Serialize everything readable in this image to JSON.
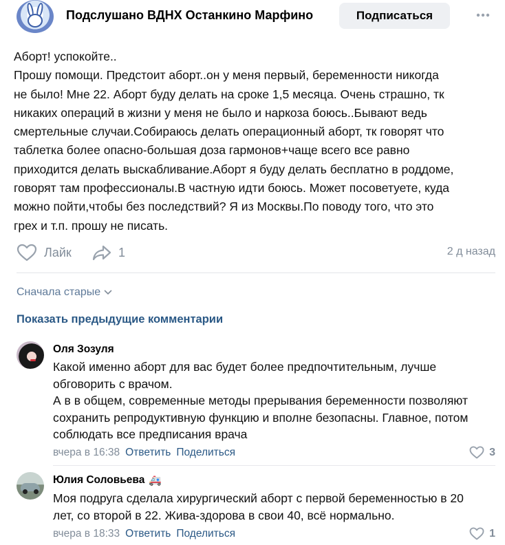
{
  "header": {
    "group_title": "Подслушано ВДНХ Останкино Марфино",
    "subscribe_label": "Подписаться"
  },
  "post": {
    "lines": [
      "Аборт! успокойте..",
      "Прошу помощи. Предстоит аборт..он у меня первый, беременности никогда",
      "не было! Мне 22. Аборт буду делать на сроке 1,5 месяца. Очень страшно, тк",
      "никаких операций в жизни у меня не было и наркоза боюсь..Бывают ведь",
      "смертельные случаи.Собираюсь делать операционный аборт, тк говорят что",
      "таблетка более опасно-большая доза гармонов+чаще всего все равно",
      "приходится делать выскабливание.Аборт я буду делать бесплатно в роддоме,",
      "говорят там профессионалы.В частную идти боюсь. Может посоветуете, куда",
      "можно пойти,чтобы без последствий? Я из Москвы.По поводу того, что это",
      "грех и т.п. прошу не писать."
    ],
    "like_label": "Лайк",
    "share_count": "1",
    "time": "2 д назад"
  },
  "comments_section": {
    "sort_label": "Сначала старые",
    "show_previous_label": "Показать предыдущие комментарии"
  },
  "comments": [
    {
      "author": "Оля Зозуля",
      "lines": [
        "Какой именно аборт для вас будет более предпочтительным, лучше",
        "обговорить с врачом.",
        "А в в общем, современные методы прерывания беременности позволяют",
        "сохранить репродуктивную функцию и вполне безопасны. Главное, потом",
        "соблюдать все предписания врача"
      ],
      "time": "вчера в 16:38",
      "reply_label": "Ответить",
      "share_label": "Поделиться",
      "likes": "3"
    },
    {
      "author": "Юлия Соловьева",
      "author_emoji": "🚑",
      "lines": [
        "Моя подруга сделала хирургический аборт с первой беременностью в 20",
        "лет, со второй в 22. Жива-здорова в свои 40, всё нормально."
      ],
      "time": "вчера в 18:33",
      "reply_label": "Ответить",
      "share_label": "Поделиться",
      "likes": "1"
    }
  ],
  "colors": {
    "link": "#2a5885",
    "secondary_text": "#818c99",
    "button_bg": "#eef0f3"
  }
}
